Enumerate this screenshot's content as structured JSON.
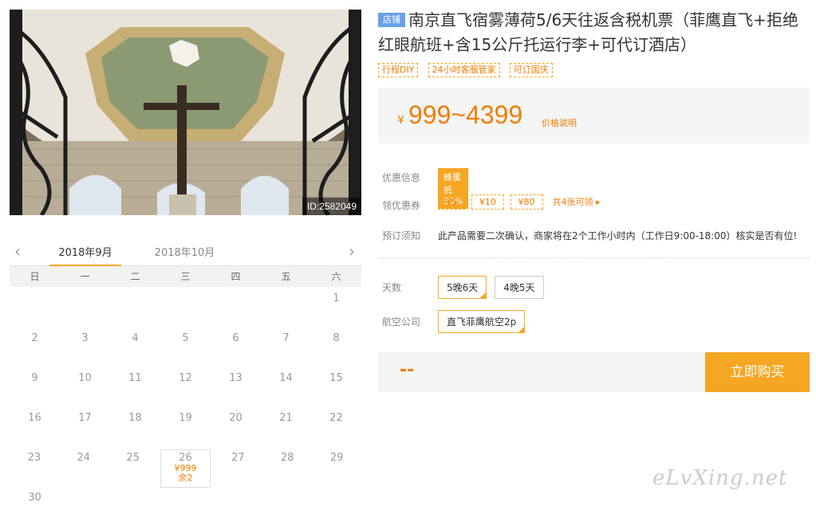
{
  "image": {
    "id_label": "ID:2582049"
  },
  "calendar": {
    "prev_icon": "chevron-left-icon",
    "next_icon": "chevron-right-icon",
    "months": [
      "2018年9月",
      "2018年10月"
    ],
    "weekdays": [
      "日",
      "一",
      "二",
      "三",
      "四",
      "五",
      "六"
    ],
    "weeks": [
      [
        "",
        "",
        "",
        "",
        "",
        "",
        "1"
      ],
      [
        "2",
        "3",
        "4",
        "5",
        "6",
        "7",
        "8"
      ],
      [
        "9",
        "10",
        "11",
        "12",
        "13",
        "14",
        "15"
      ],
      [
        "16",
        "17",
        "18",
        "19",
        "20",
        "21",
        "22"
      ],
      [
        "23",
        "24",
        "25",
        "26",
        "27",
        "28",
        "29"
      ],
      [
        "30",
        "",
        "",
        "",
        "",
        "",
        ""
      ]
    ],
    "selected": {
      "day": "26",
      "price": "¥999",
      "remain": "余2"
    }
  },
  "product": {
    "shop_badge": "店铺",
    "title": "南京直飞宿雾薄荷5/6天往返含税机票（菲鹰直飞+拒绝红眼航班+含15公斤托运行李+可代订酒店）",
    "tags": [
      "行程DIY",
      "24小时客服管家",
      "可订国庆"
    ]
  },
  "price": {
    "currency": "¥",
    "range": "999~4399",
    "note": "价格说明"
  },
  "promo": {
    "label": "优惠信息",
    "badge": "蜂蜜抵30%"
  },
  "coupons": {
    "label": "领优惠券",
    "items": [
      "¥5",
      "¥10",
      "¥80"
    ],
    "more": "共4张可领 ▸"
  },
  "booking": {
    "label": "预订须知",
    "text": "此产品需要二次确认，商家将在2个工作小时内（工作日9:00-18:00）核实是否有位!"
  },
  "days": {
    "label": "天数",
    "options": [
      "5晚6天",
      "4晚5天"
    ]
  },
  "airline": {
    "label": "航空公司",
    "options": [
      "直飞菲鹰航空2p"
    ]
  },
  "buy": {
    "price_placeholder": "--",
    "button": "立即购买"
  },
  "watermark": "eLvXing.net",
  "colors": {
    "accent": "#f5a623",
    "price": "#f27c00",
    "shop_badge": "#6aa0e8"
  }
}
